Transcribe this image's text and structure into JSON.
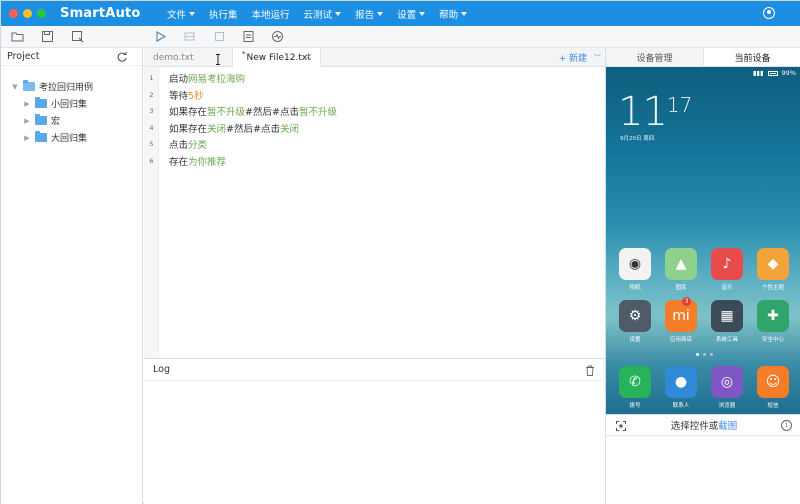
{
  "app": {
    "name": "SmartAuto"
  },
  "menu": [
    {
      "label": "文件",
      "has_dropdown": true
    },
    {
      "label": "执行集",
      "has_dropdown": false
    },
    {
      "label": "本地运行",
      "has_dropdown": false
    },
    {
      "label": "云测试",
      "has_dropdown": true
    },
    {
      "label": "报告",
      "has_dropdown": true
    },
    {
      "label": "设置",
      "has_dropdown": true
    },
    {
      "label": "帮助",
      "has_dropdown": true
    }
  ],
  "project": {
    "title": "Project",
    "root": "考拉回归用例",
    "children": [
      "小回归集",
      "宏",
      "大回归集"
    ]
  },
  "tabs": {
    "inactive": "demo.txt",
    "active": "New File12.txt",
    "active_modified_marker": "*",
    "close_glyph": "×",
    "new_label": "+ 新建"
  },
  "code": [
    {
      "n": "1",
      "parts": [
        {
          "t": "启动",
          "c": "kw"
        },
        {
          "t": "网易考拉海购",
          "c": "arg"
        }
      ]
    },
    {
      "n": "2",
      "parts": [
        {
          "t": "等待",
          "c": "kw"
        },
        {
          "t": "5秒",
          "c": "num"
        }
      ]
    },
    {
      "n": "3",
      "parts": [
        {
          "t": "如果存在",
          "c": "kw"
        },
        {
          "t": "暂不升级",
          "c": "arg"
        },
        {
          "t": "#然后#点击",
          "c": "kw"
        },
        {
          "t": "暂不升级",
          "c": "arg"
        }
      ]
    },
    {
      "n": "4",
      "parts": [
        {
          "t": "如果存在",
          "c": "kw"
        },
        {
          "t": "关闭",
          "c": "arg"
        },
        {
          "t": "#然后#点击",
          "c": "kw"
        },
        {
          "t": "关闭",
          "c": "arg"
        }
      ]
    },
    {
      "n": "5",
      "parts": [
        {
          "t": "点击",
          "c": "kw"
        },
        {
          "t": "分类",
          "c": "arg"
        }
      ]
    },
    {
      "n": "6",
      "parts": [
        {
          "t": "存在",
          "c": "kw"
        },
        {
          "t": "为你推荐",
          "c": "arg"
        }
      ]
    }
  ],
  "log": {
    "title": "Log"
  },
  "device": {
    "tab_manage": "设备管理",
    "tab_current": "当前设备",
    "status_right": "99%",
    "clock_hour": "11",
    "clock_min": "17",
    "date": "9月20日 周四",
    "apps": [
      {
        "label": "相机",
        "color": "#f2f2f2",
        "glyph": "◉",
        "fg": "#333"
      },
      {
        "label": "图库",
        "color": "#8fd18a",
        "glyph": "▲",
        "fg": "#fff"
      },
      {
        "label": "音乐",
        "color": "#e84b4b",
        "glyph": "♪",
        "fg": "#fff"
      },
      {
        "label": "个性主题",
        "color": "#f2a33a",
        "glyph": "◆",
        "fg": "#fff"
      },
      {
        "label": "设置",
        "color": "#4f5b66",
        "glyph": "⚙",
        "fg": "#fff"
      },
      {
        "label": "应用商店",
        "color": "#f57c29",
        "glyph": "mi",
        "fg": "#fff",
        "badge": "3"
      },
      {
        "label": "系统工具",
        "color": "#3d4a57",
        "glyph": "▦",
        "fg": "#fff"
      },
      {
        "label": "安全中心",
        "color": "#2fa56b",
        "glyph": "✚",
        "fg": "#fff"
      },
      {
        "label": "拨号",
        "color": "#27b35a",
        "glyph": "✆",
        "fg": "#fff"
      },
      {
        "label": "联系人",
        "color": "#2f8ad8",
        "glyph": "●",
        "fg": "#fff"
      },
      {
        "label": "浏览器",
        "color": "#7e57c2",
        "glyph": "◎",
        "fg": "#fff"
      },
      {
        "label": "短信",
        "color": "#f57c29",
        "glyph": "☺",
        "fg": "#fff"
      }
    ],
    "select_prefix": "选择控件或",
    "select_link": "截图",
    "info_glyph": "i"
  }
}
